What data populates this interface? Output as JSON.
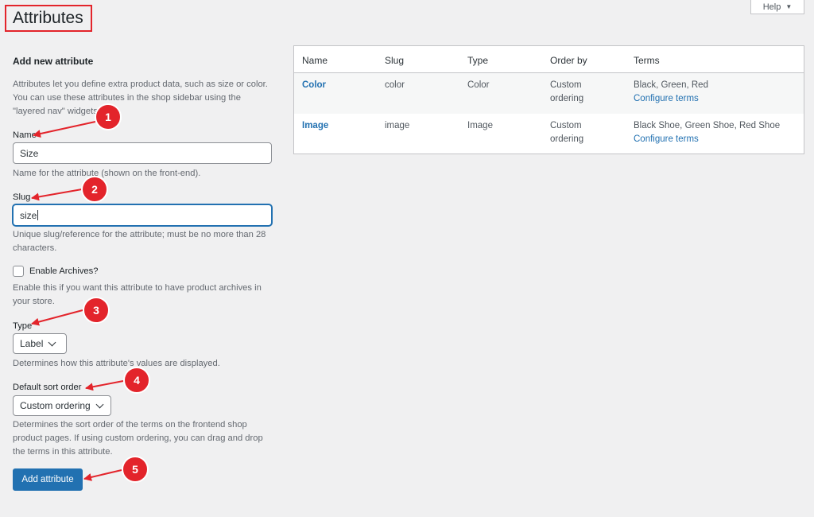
{
  "page": {
    "title": "Attributes",
    "help_label": "Help"
  },
  "form": {
    "heading": "Add new attribute",
    "intro": "Attributes let you define extra product data, such as size or color. You can use these attributes in the shop sidebar using the \"layered nav\" widgets.",
    "name_label": "Name",
    "name_value": "Size",
    "name_help": "Name for the attribute (shown on the front-end).",
    "slug_label": "Slug",
    "slug_value": "size",
    "slug_help": "Unique slug/reference for the attribute; must be no more than 28 characters.",
    "archives_label": "Enable Archives?",
    "archives_checked": false,
    "archives_help": "Enable this if you want this attribute to have product archives in your store.",
    "type_label": "Type",
    "type_value": "Label",
    "type_help": "Determines how this attribute's values are displayed.",
    "sort_label": "Default sort order",
    "sort_value": "Custom ordering",
    "sort_help": "Determines the sort order of the terms on the frontend shop product pages. If using custom ordering, you can drag and drop the terms in this attribute.",
    "submit_label": "Add attribute"
  },
  "table": {
    "columns": [
      "Name",
      "Slug",
      "Type",
      "Order by",
      "Terms"
    ],
    "rows": [
      {
        "name": "Color",
        "slug": "color",
        "type": "Color",
        "order_by": "Custom ordering",
        "terms": "Black, Green, Red",
        "configure": "Configure terms"
      },
      {
        "name": "Image",
        "slug": "image",
        "type": "Image",
        "order_by": "Custom ordering",
        "terms": "Black Shoe, Green Shoe, Red Shoe",
        "configure": "Configure terms"
      }
    ]
  },
  "annotations": [
    "1",
    "2",
    "3",
    "4",
    "5"
  ],
  "colors": {
    "accent": "#2271b1",
    "marker": "#e3242b",
    "background": "#f0f0f1"
  }
}
